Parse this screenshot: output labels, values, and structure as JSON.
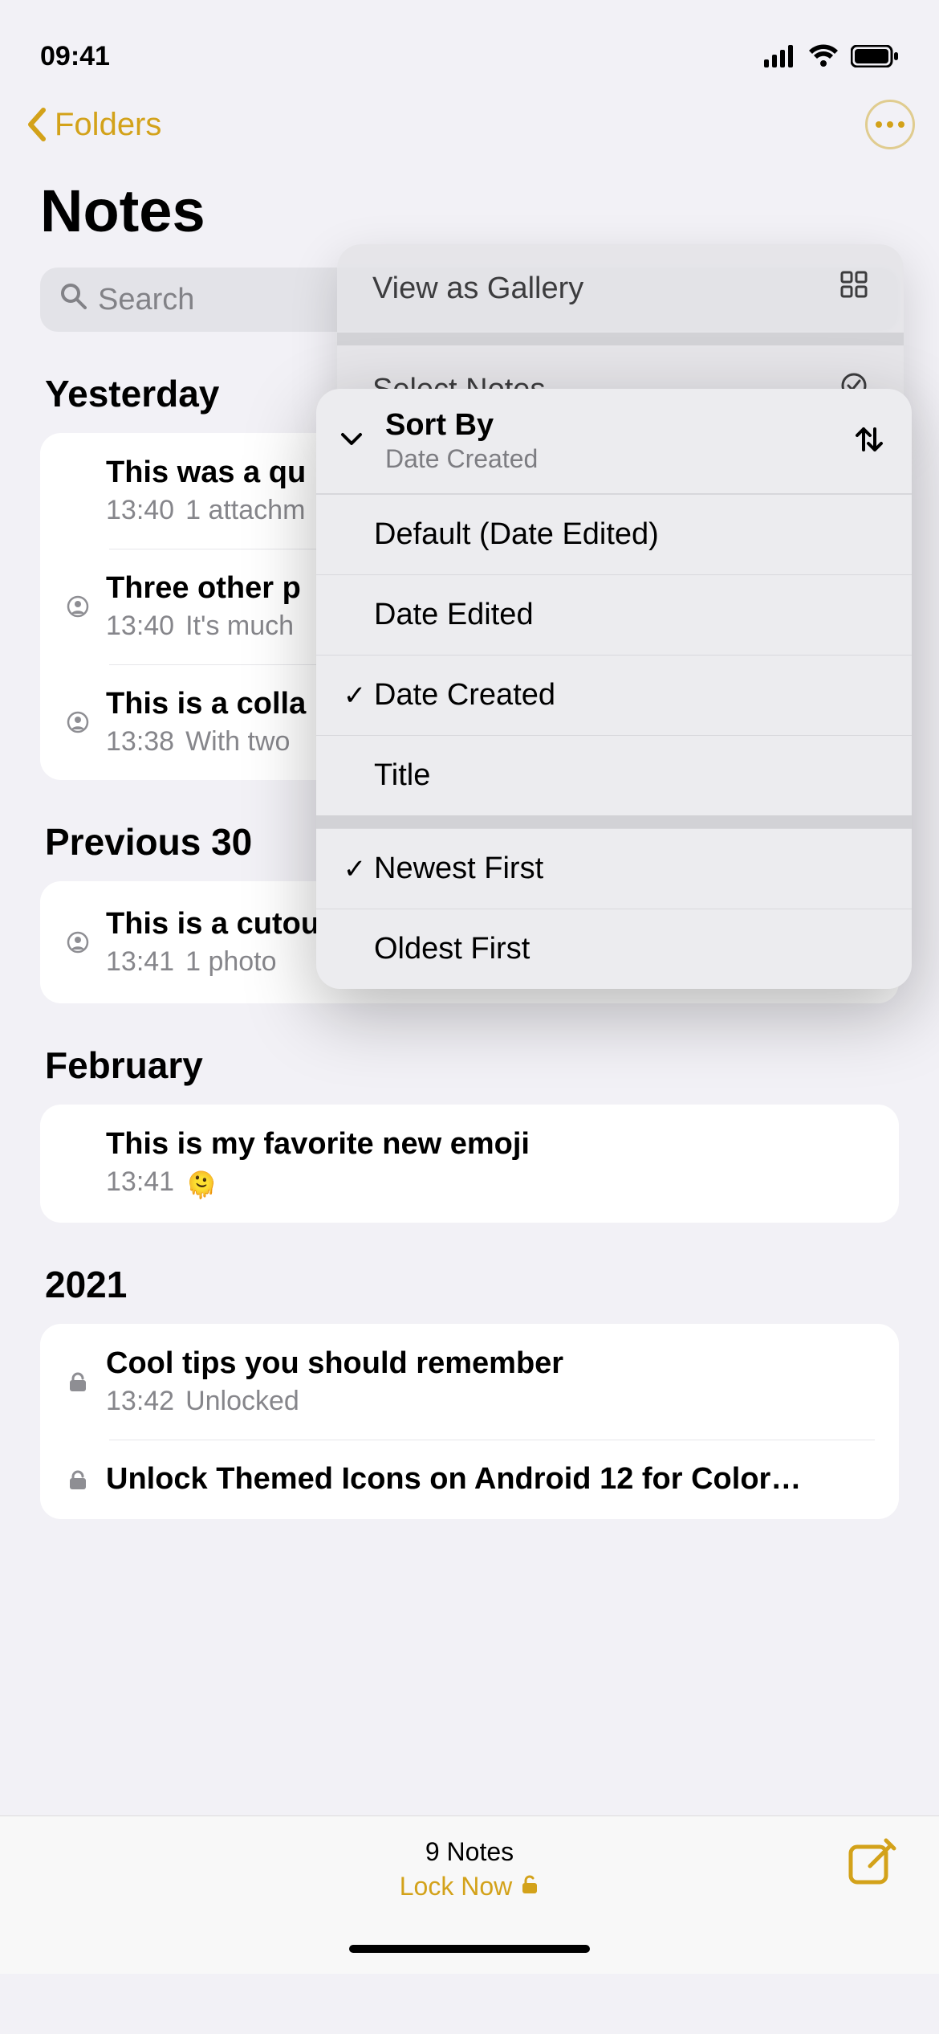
{
  "status": {
    "time": "09:41"
  },
  "nav": {
    "back_label": "Folders"
  },
  "title": "Notes",
  "search": {
    "placeholder": "Search"
  },
  "sections": [
    {
      "header": "Yesterday",
      "notes": [
        {
          "icon": null,
          "title": "This was a qu",
          "time": "13:40",
          "sub": "1 attachm"
        },
        {
          "icon": "shared",
          "title": "Three other p",
          "time": "13:40",
          "sub": "It's much"
        },
        {
          "icon": "shared",
          "title": "This is a colla",
          "time": "13:38",
          "sub": "With two"
        }
      ]
    },
    {
      "header": "Previous 30 ",
      "notes": [
        {
          "icon": "shared",
          "title": "This is a cutout from a photo",
          "time": "13:41",
          "sub": "1 photo",
          "thumb": true
        }
      ]
    },
    {
      "header": "February",
      "notes": [
        {
          "icon": null,
          "title": "This is my favorite new emoji",
          "time": "13:41",
          "sub_emoji": "🫠"
        }
      ]
    },
    {
      "header": "2021",
      "notes": [
        {
          "icon": "lock",
          "title": "Cool tips you should remember",
          "time": "13:42",
          "sub": "Unlocked"
        },
        {
          "icon": "lock",
          "title": "Unlock Themed Icons on Android 12 for Color…"
        }
      ]
    }
  ],
  "bottom": {
    "count": "9 Notes",
    "lock": "Lock Now"
  },
  "menu_top": {
    "view_gallery": "View as Gallery",
    "select_notes": "Select Notes"
  },
  "sort_menu": {
    "header_title": "Sort By",
    "header_subtitle": "Date Created",
    "options": [
      {
        "label": "Default (Date Edited)",
        "checked": false
      },
      {
        "label": "Date Edited",
        "checked": false
      },
      {
        "label": "Date Created",
        "checked": true
      },
      {
        "label": "Title",
        "checked": false
      }
    ],
    "order": [
      {
        "label": "Newest First",
        "checked": true
      },
      {
        "label": "Oldest First",
        "checked": false
      }
    ]
  }
}
